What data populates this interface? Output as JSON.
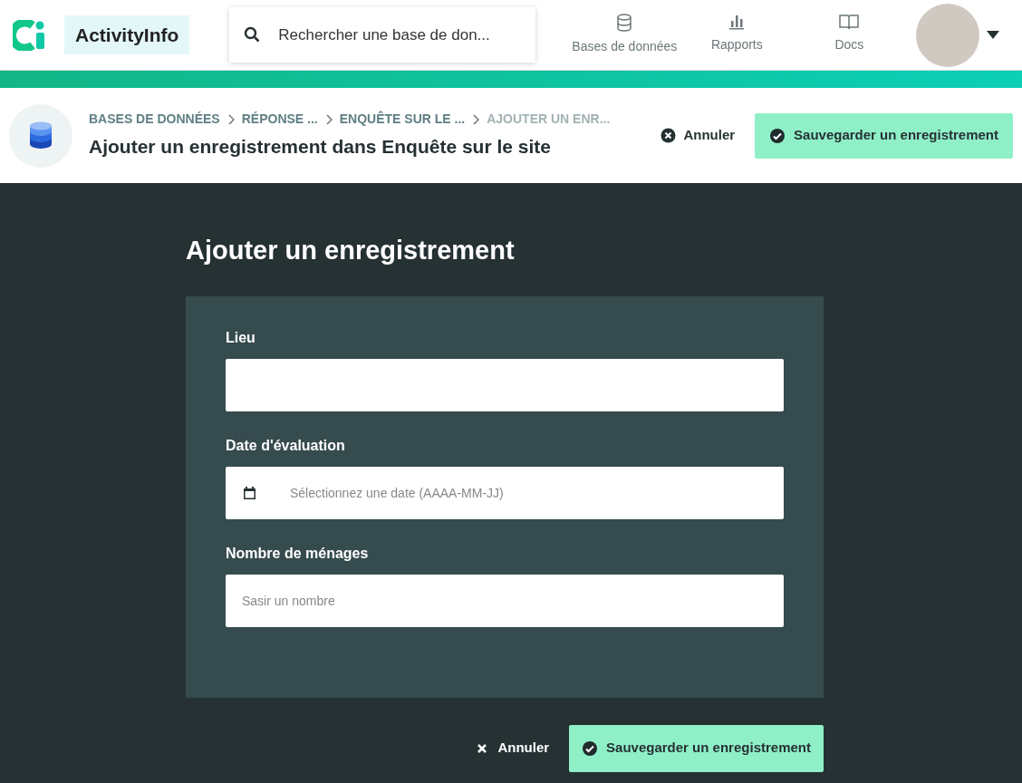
{
  "header": {
    "logo": "ActivityInfo",
    "search": {
      "placeholder": "Rechercher une base de don..."
    },
    "nav": [
      {
        "label": "Bases de données",
        "kind": "database"
      },
      {
        "label": "Rapports",
        "kind": "chart"
      },
      {
        "label": "Docs",
        "kind": "book"
      }
    ]
  },
  "breadcrumbs": [
    "BASES DE DONNÉES",
    "RÉPONSE ...",
    "ENQUÊTE SUR LE ...",
    "AJOUTER UN ENR..."
  ],
  "page_title": "Ajouter un enregistrement dans Enquête sur le site",
  "top_actions": {
    "cancel": "Annuler",
    "save": "Sauvegarder un enregistrement"
  },
  "form": {
    "title": "Ajouter un enregistrement",
    "fields": [
      {
        "label": "Lieu",
        "kind": "text"
      },
      {
        "label": "Date d'évaluation",
        "kind": "date",
        "placeholder": "Sélectionnez une date (AAAA-MM-JJ)"
      },
      {
        "label": "Nombre de ménages",
        "kind": "number",
        "placeholder": "Sasir un nombre"
      }
    ]
  },
  "bottom_actions": {
    "cancel": "Annuler",
    "save": "Sauvegarder un enregistrement"
  }
}
